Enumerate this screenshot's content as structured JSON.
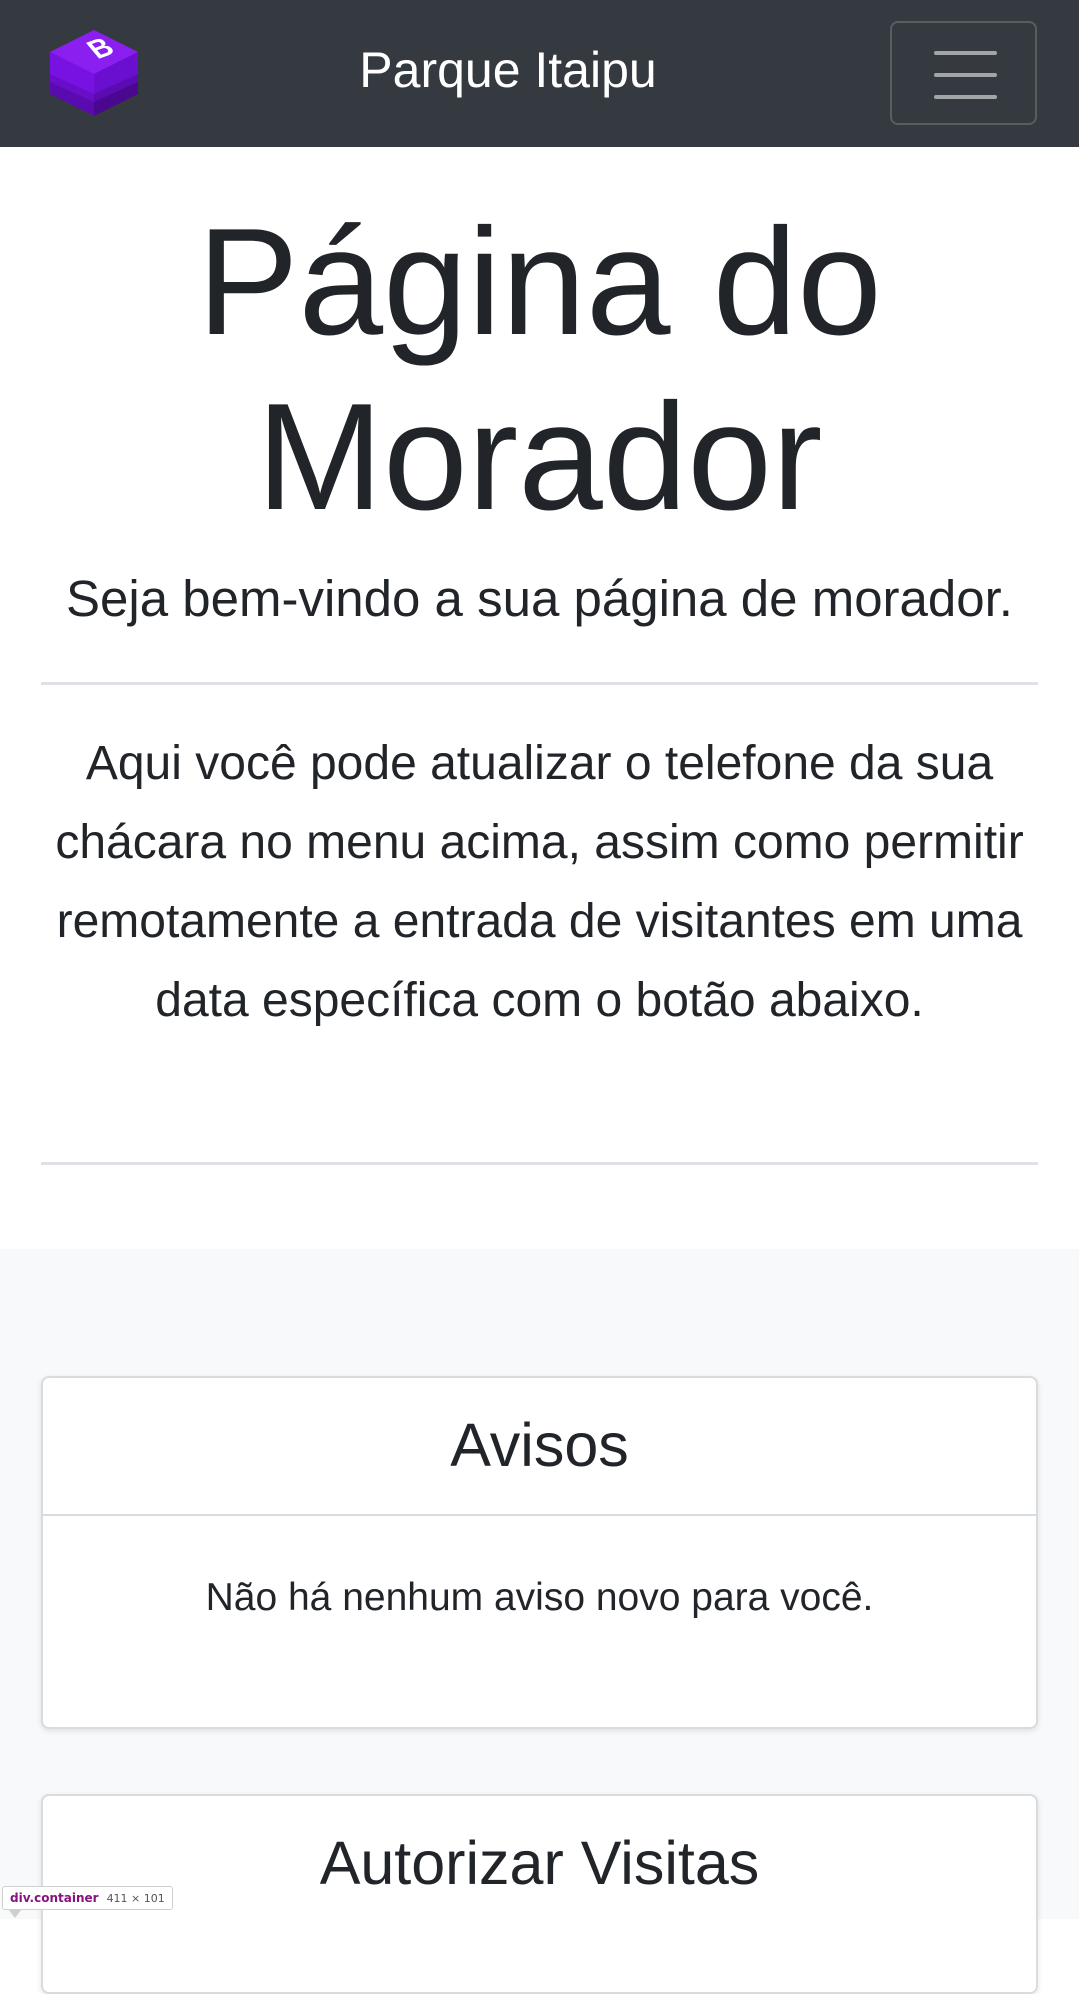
{
  "navbar": {
    "brand_title": "Parque Itaipu",
    "logo_icon": "bootstrap-logo-icon",
    "toggler_icon": "hamburger-menu-icon",
    "logo_color": "#7a11e0",
    "background": "#343a40"
  },
  "hero": {
    "title": "Página do Morador",
    "lead": "Seja bem-vindo a sua página de morador.",
    "body": "Aqui você pode atualizar o telefone da sua chácara no menu acima, assim como permitir remotamente a entrada de visitantes em uma data específica com o botão abaixo."
  },
  "cards": {
    "avisos": {
      "header": "Avisos",
      "body": "Não há nenhum aviso novo para você."
    },
    "visitas": {
      "header": "Autorizar Visitas"
    }
  },
  "devtools_tooltip": {
    "element": "div.container",
    "dimensions": "411 × 101"
  }
}
